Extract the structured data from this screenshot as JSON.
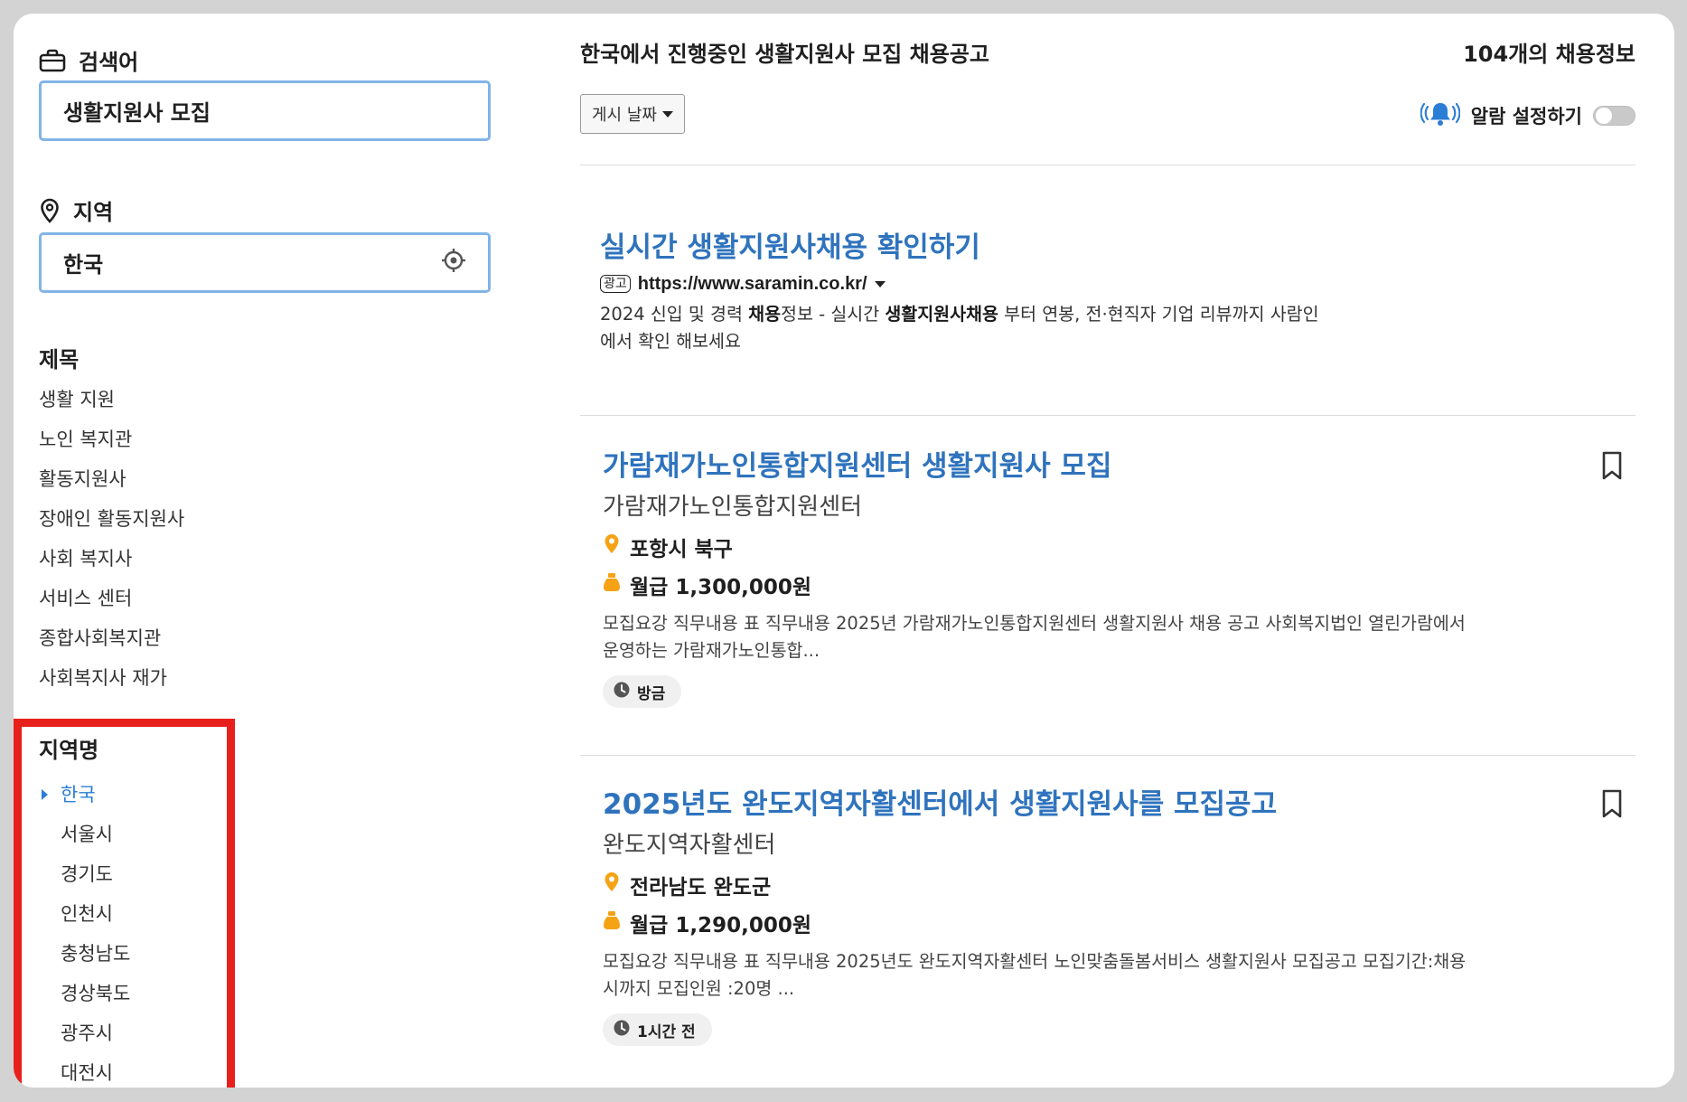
{
  "sidebar": {
    "keyword_label": "검색어",
    "keyword_value": "생활지원사 모집",
    "location_label": "지역",
    "location_value": "한국",
    "title_section": "제목",
    "title_filters": [
      "생활 지원",
      "노인 복지관",
      "활동지원사",
      "장애인 활동지원사",
      "사회 복지사",
      "서비스 센터",
      "종합사회복지관",
      "사회복지사 재가"
    ],
    "region_section": "지역명",
    "regions": [
      "한국",
      "서울시",
      "경기도",
      "인천시",
      "충청남도",
      "경상북도",
      "광주시",
      "대전시"
    ],
    "active_region": "한국"
  },
  "header": {
    "heading": "한국에서 진행중인 생활지원사 모집 채용공고",
    "count": "104개의 채용정보",
    "sort_label": "게시 날짜",
    "alarm_label": "알람 설정하기",
    "alarm_on": false
  },
  "ad": {
    "title": "실시간 생활지원사채용 확인하기",
    "badge": "광고",
    "url": "https://www.saramin.co.kr/",
    "desc_parts": [
      "2024 신입 및 경력 ",
      "채용",
      "정보 - 실시간 ",
      "생활지원사채용",
      " 부터 연봉, 전·현직자 기업 리뷰까지 사람인",
      "에서 확인 해보세요"
    ]
  },
  "jobs": [
    {
      "title": "가람재가노인통합지원센터 생활지원사 모집",
      "company": "가람재가노인통합지원센터",
      "location": "포항시 북구",
      "salary": "월급 1,300,000원",
      "desc_line1": "모집요강 직무내용 표 직무내용 2025년 가람재가노인통합지원센터 생활지원사 채용 공고 사회복지법인 열린가람에서",
      "desc_line2": "운영하는 가람재가노인통합...",
      "posted": "방금"
    },
    {
      "title": "2025년도 완도지역자활센터에서 생활지원사를 모집공고",
      "company": "완도지역자활센터",
      "location": "전라남도 완도군",
      "salary": "월급 1,290,000원",
      "desc_line1": "모집요강 직무내용 표 직무내용 2025년도 완도지역자활센터 노인맞춤돌봄서비스 생활지원사 모집공고 모집기간:채용",
      "desc_line2": "시까지 모집인원 :20명 ...",
      "posted": "1시간 전"
    }
  ],
  "colors": {
    "accent": "#2f73bd",
    "input_border": "#82b4e6",
    "highlight": "#e8201c",
    "icon_orange": "#f5a314",
    "bell_blue": "#2b7ed6"
  },
  "icons": [
    "briefcase-icon",
    "location-pin-icon",
    "crosshair-icon",
    "bell-icon",
    "bookmark-icon",
    "clock-icon",
    "money-bag-icon"
  ]
}
